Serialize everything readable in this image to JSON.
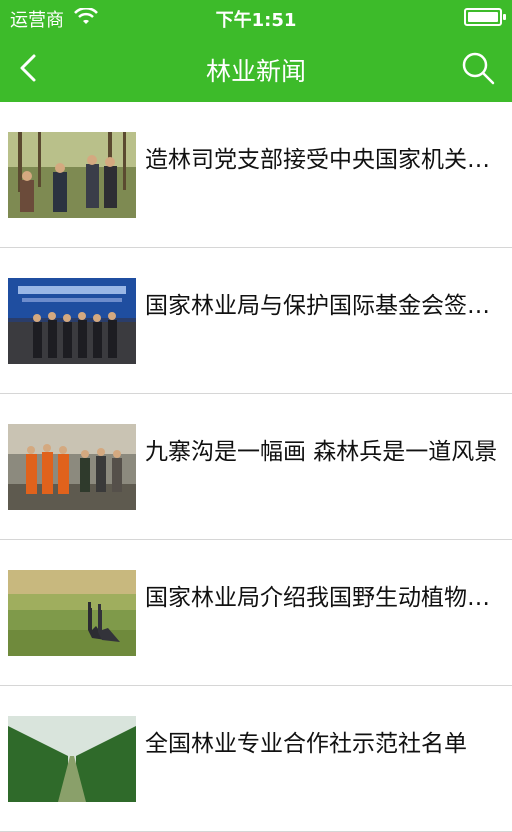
{
  "status": {
    "carrier": "运营商",
    "time": "下午1:51"
  },
  "nav": {
    "title": "林业新闻",
    "back_icon": "chevron-left-icon",
    "search_icon": "search-icon"
  },
  "news": [
    {
      "title": "造林司党支部接受中央国家机关……"
    },
    {
      "title": "国家林业局与保护国际基金会签署……"
    },
    {
      "title": "九寨沟是一幅画 森林兵是一道风景"
    },
    {
      "title": "国家林业局介绍我国野生动植物保护"
    },
    {
      "title": "全国林业专业合作社示范社名单"
    }
  ]
}
